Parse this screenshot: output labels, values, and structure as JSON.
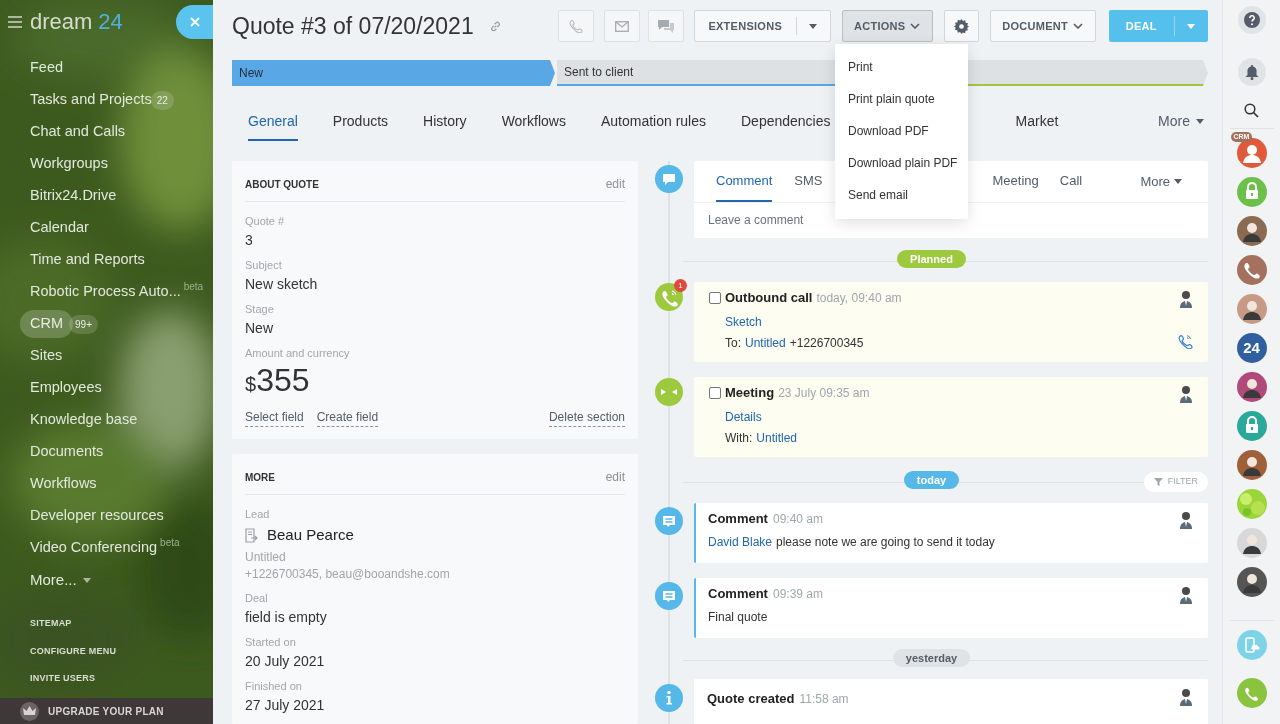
{
  "sidebar": {
    "brand": "dream",
    "brand_number": "24",
    "items": [
      {
        "label": "Feed",
        "selected": false
      },
      {
        "label": "Tasks and Projects",
        "counter": "22",
        "selected": false
      },
      {
        "label": "Chat and Calls",
        "selected": false
      },
      {
        "label": "Workgroups",
        "selected": false
      },
      {
        "label": "Bitrix24.Drive",
        "selected": false
      },
      {
        "label": "Calendar",
        "selected": false
      },
      {
        "label": "Time and Reports",
        "selected": false
      },
      {
        "label": "Robotic Process Auto...",
        "suffix": "beta",
        "selected": false
      },
      {
        "label": "CRM",
        "counter": "99+",
        "selected": true
      },
      {
        "label": "Sites",
        "selected": false
      },
      {
        "label": "Employees",
        "selected": false
      },
      {
        "label": "Knowledge base",
        "selected": false
      },
      {
        "label": "Documents",
        "selected": false
      },
      {
        "label": "Workflows",
        "selected": false
      },
      {
        "label": "Developer resources",
        "selected": false
      },
      {
        "label": "Video Conferencing",
        "suffix": "beta",
        "selected": false
      }
    ],
    "more": "More...",
    "links": [
      "SITEMAP",
      "CONFIGURE MENU",
      "INVITE USERS"
    ],
    "upgrade": "UPGRADE YOUR PLAN"
  },
  "header": {
    "title": "Quote #3 of 07/20/2021",
    "buttons": [
      {
        "kind": "split",
        "label": "EXTENSIONS",
        "pressed": false
      },
      {
        "kind": "dropdown",
        "label": "ACTIONS",
        "pressed": true
      },
      {
        "kind": "settings",
        "pressed": false
      },
      {
        "kind": "dropdown",
        "label": "DOCUMENT",
        "pressed": false
      },
      {
        "kind": "primary",
        "label": "DEAL",
        "pressed": false
      }
    ]
  },
  "stages": [
    {
      "label": "New",
      "kind": "current"
    },
    {
      "label": "Sent to client",
      "kind": "pending"
    },
    {
      "kind": "final"
    }
  ],
  "tabs": [
    {
      "label": "General",
      "selected": true
    },
    {
      "label": "Products",
      "selected": false
    },
    {
      "label": "History",
      "selected": false
    },
    {
      "label": "Workflows",
      "selected": false
    },
    {
      "label": "Automation rules",
      "selected": false
    },
    {
      "label": "Dependencies",
      "selected": false
    },
    {
      "label": "Market",
      "selected": false
    }
  ],
  "tabs_more": "More",
  "actions_menu": [
    "Print",
    "Print plain quote",
    "Download PDF",
    "Download plain PDF",
    "Send email"
  ],
  "about_card": {
    "title": "ABOUT QUOTE",
    "edit": "edit",
    "fields": [
      {
        "label": "Quote #",
        "value": "3"
      },
      {
        "label": "Subject",
        "value": "New sketch"
      },
      {
        "label": "Stage",
        "value": "New"
      }
    ],
    "amount_label": "Amount and currency",
    "currency": "$",
    "amount": "355",
    "actions": [
      "Select field",
      "Create field",
      "Delete section"
    ]
  },
  "more_card": {
    "title": "MORE",
    "edit": "edit",
    "lead_label": "Lead",
    "lead_name": "Beau Pearce",
    "lead_company": "Untitled",
    "lead_contact": "+1226700345, beau@booandshe.com",
    "fields": [
      {
        "label": "Deal",
        "value": "field is empty"
      },
      {
        "label": "Started on",
        "value": "20 July 2021"
      },
      {
        "label": "Finished on",
        "value": "27 July 2021"
      }
    ]
  },
  "editor": {
    "tabs": [
      {
        "label": "Comment",
        "selected": true
      },
      {
        "label": "SMS",
        "selected": false
      },
      {
        "label": "Meeting",
        "selected": false
      },
      {
        "label": "Call",
        "selected": false
      }
    ],
    "more": "More",
    "placeholder": "Leave a comment"
  },
  "timeline": [
    {
      "kind": "divider",
      "label": "Planned",
      "color": "#9dc93f"
    },
    {
      "kind": "call",
      "title": "Outbound call",
      "time": "today, 09:40 am",
      "counter": "1",
      "checked": false,
      "link": "Sketch",
      "target_label": "To:",
      "target_link": "Untitled",
      "target_extra": "+1226700345"
    },
    {
      "kind": "meeting",
      "title": "Meeting",
      "time": "23 July 09:35 am",
      "checked": false,
      "link": "Details",
      "target_label": "With:",
      "target_link": "Untitled"
    },
    {
      "kind": "divider",
      "label": "today",
      "color": "#55b8e8",
      "filter": "FILTER"
    },
    {
      "kind": "comment",
      "title": "Comment",
      "time": "09:40 am",
      "author": "David Blake",
      "text": "please note we are going to send it today"
    },
    {
      "kind": "comment",
      "title": "Comment",
      "time": "09:39 am",
      "text": "Final quote"
    },
    {
      "kind": "divider",
      "label": "yesterday",
      "color": "#dfe3e6"
    },
    {
      "kind": "info",
      "title": "Quote created",
      "time": "11:58 am"
    }
  ],
  "right_bar": {
    "contacts": [
      {
        "kind": "crm",
        "color": "#e0593a",
        "badge": "CRM"
      },
      {
        "kind": "lock",
        "color": "#6cc04a"
      },
      {
        "kind": "person",
        "color": "#8a6a50"
      },
      {
        "kind": "phone",
        "color": "#a5715f"
      },
      {
        "kind": "person",
        "color": "#c79a86"
      },
      {
        "kind": "counter",
        "color": "#2f5f9e",
        "label": "24"
      },
      {
        "kind": "person",
        "color": "#b04a7a"
      },
      {
        "kind": "lock",
        "color": "#2aa89a"
      },
      {
        "kind": "person",
        "color": "#a0603a"
      },
      {
        "kind": "pattern",
        "color": "#9ad63a"
      },
      {
        "kind": "person",
        "color": "#d8d8d8"
      },
      {
        "kind": "person",
        "color": "#555555"
      }
    ]
  }
}
